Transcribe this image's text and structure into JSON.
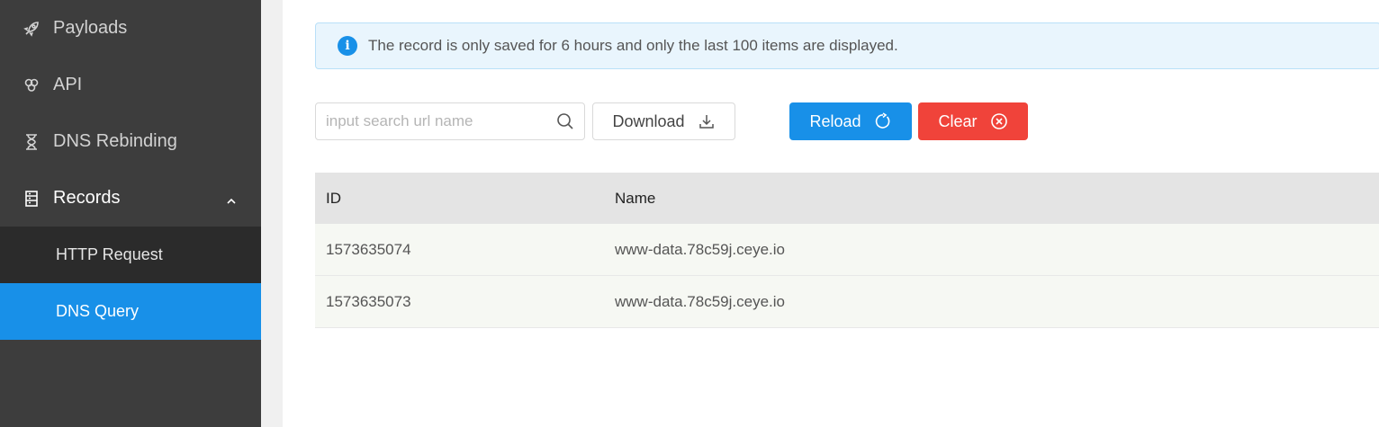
{
  "sidebar": {
    "items": [
      {
        "label": "Payloads",
        "icon": "rocket-icon"
      },
      {
        "label": "API",
        "icon": "api-icon"
      },
      {
        "label": "DNS Rebinding",
        "icon": "hourglass-icon"
      },
      {
        "label": "Records",
        "icon": "records-icon",
        "expanded": true
      }
    ],
    "subitems": [
      {
        "label": "HTTP Request",
        "active": false
      },
      {
        "label": "DNS Query",
        "active": true
      }
    ]
  },
  "alert": {
    "icon": "info-icon",
    "text": "The record is only saved for 6 hours and only the last 100 items are displayed."
  },
  "toolbar": {
    "search_placeholder": "input search url name",
    "search_value": "",
    "download_label": "Download",
    "reload_label": "Reload",
    "clear_label": "Clear"
  },
  "table": {
    "headers": [
      "ID",
      "Name"
    ],
    "rows": [
      {
        "id": "1573635074",
        "name": "www-data.78c59j.ceye.io"
      },
      {
        "id": "1573635073",
        "name": "www-data.78c59j.ceye.io"
      }
    ]
  },
  "colors": {
    "sidebar_bg": "#3d3d3d",
    "accent_blue": "#1890e8",
    "danger_red": "#f0433a",
    "alert_bg": "#e9f5fd"
  }
}
